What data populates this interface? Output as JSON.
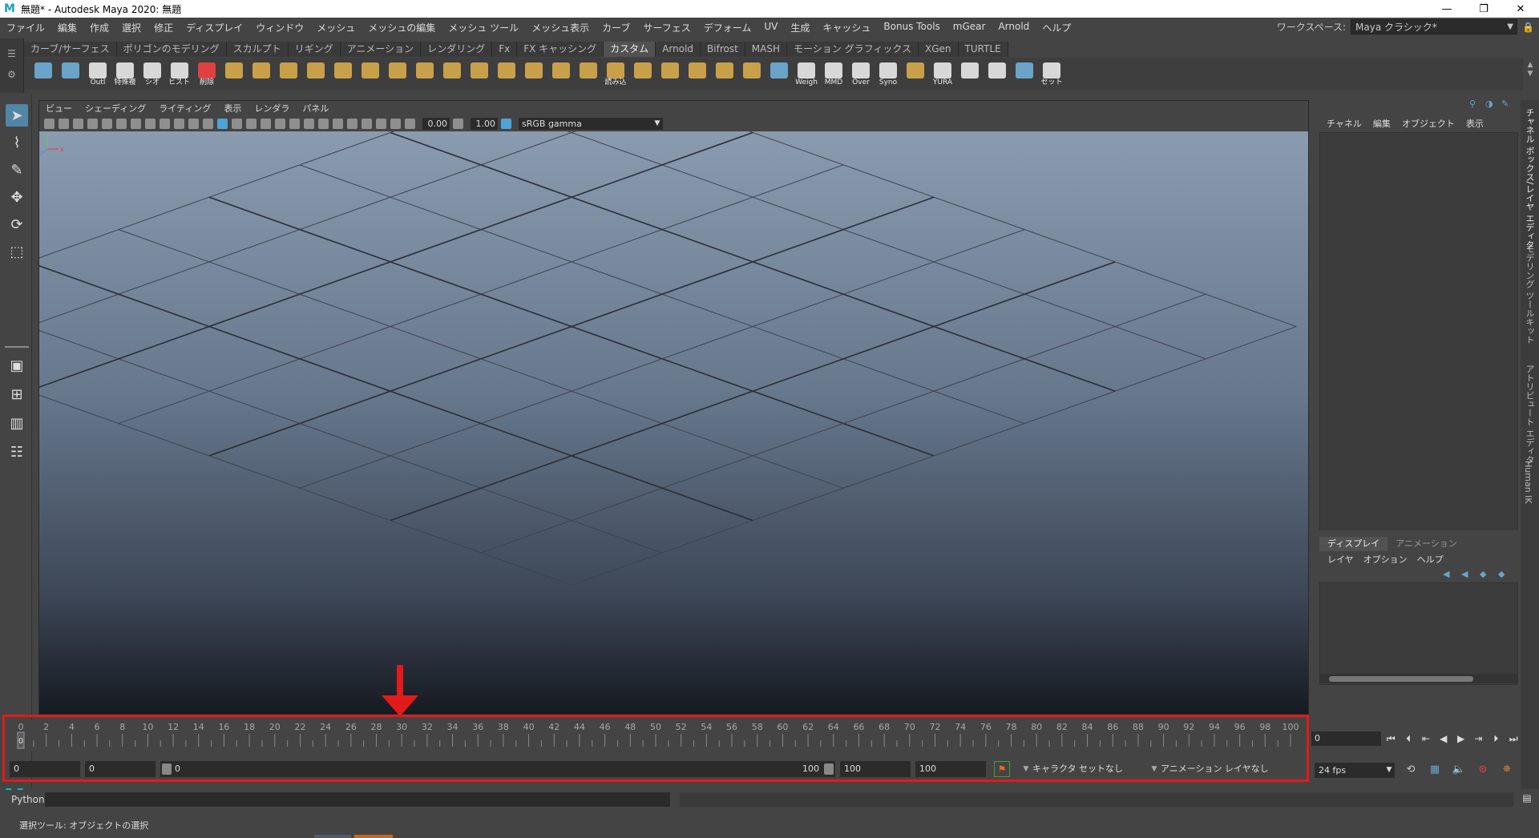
{
  "window": {
    "title": "無題* - Autodesk Maya 2020: 無題",
    "minimize": "—",
    "maximize": "❐",
    "close": "✕"
  },
  "menubar": {
    "items": [
      "ファイル",
      "編集",
      "作成",
      "選択",
      "修正",
      "ディスプレイ",
      "ウィンドウ",
      "メッシュ",
      "メッシュの編集",
      "メッシュ ツール",
      "メッシュ表示",
      "カーブ",
      "サーフェス",
      "デフォーム",
      "UV",
      "生成",
      "キャッシュ",
      "Bonus Tools",
      "mGear",
      "Arnold",
      "ヘルプ"
    ],
    "workspace_label": "ワークスペース:",
    "workspace_value": "Maya クラシック*"
  },
  "shelf_tabs": [
    {
      "label": "カーブ/サーフェス",
      "active": false
    },
    {
      "label": "ポリゴンのモデリング",
      "active": false
    },
    {
      "label": "スカルプト",
      "active": false
    },
    {
      "label": "リギング",
      "active": false
    },
    {
      "label": "アニメーション",
      "active": false
    },
    {
      "label": "レンダリング",
      "active": false
    },
    {
      "label": "Fx",
      "active": false
    },
    {
      "label": "FX キャッシング",
      "active": false
    },
    {
      "label": "カスタム",
      "active": true
    },
    {
      "label": "Arnold",
      "active": false
    },
    {
      "label": "Bifrost",
      "active": false
    },
    {
      "label": "MASH",
      "active": false
    },
    {
      "label": "モーション グラフィックス",
      "active": false
    },
    {
      "label": "XGen",
      "active": false
    },
    {
      "label": "TURTLE",
      "active": false
    }
  ],
  "shelf_icons": [
    {
      "name": "outliner-icon",
      "caption": "",
      "tone": "b"
    },
    {
      "name": "asterisk-icon",
      "caption": "",
      "tone": "b"
    },
    {
      "name": "outl-icon",
      "caption": "Outl",
      "tone": "w"
    },
    {
      "name": "script1-icon",
      "caption": "特殊複",
      "tone": "w"
    },
    {
      "name": "script2-icon",
      "caption": "シオ",
      "tone": "w"
    },
    {
      "name": "script3-icon",
      "caption": "ヒストリ",
      "tone": "w"
    },
    {
      "name": "script4-icon",
      "caption": "削除",
      "tone": "r"
    },
    {
      "name": "tool1-icon",
      "caption": "",
      "tone": ""
    },
    {
      "name": "tool2-icon",
      "caption": "",
      "tone": ""
    },
    {
      "name": "tool3-icon",
      "caption": "",
      "tone": ""
    },
    {
      "name": "tool4-icon",
      "caption": "",
      "tone": ""
    },
    {
      "name": "tool5-icon",
      "caption": "",
      "tone": ""
    },
    {
      "name": "tool6-icon",
      "caption": "",
      "tone": ""
    },
    {
      "name": "tool7-icon",
      "caption": "",
      "tone": ""
    },
    {
      "name": "tool8-icon",
      "caption": "",
      "tone": ""
    },
    {
      "name": "tool9-icon",
      "caption": "",
      "tone": ""
    },
    {
      "name": "tool10-icon",
      "caption": "",
      "tone": ""
    },
    {
      "name": "tool11-icon",
      "caption": "",
      "tone": ""
    },
    {
      "name": "tool12-icon",
      "caption": "",
      "tone": ""
    },
    {
      "name": "tool13-icon",
      "caption": "",
      "tone": ""
    },
    {
      "name": "tool14-icon",
      "caption": "",
      "tone": ""
    },
    {
      "name": "read-icon",
      "caption": "読み込",
      "tone": ""
    },
    {
      "name": "tool15-icon",
      "caption": "",
      "tone": ""
    },
    {
      "name": "tool16-icon",
      "caption": "",
      "tone": ""
    },
    {
      "name": "tool17-icon",
      "caption": "",
      "tone": ""
    },
    {
      "name": "tool18-icon",
      "caption": "",
      "tone": ""
    },
    {
      "name": "tool19-icon",
      "caption": "",
      "tone": ""
    },
    {
      "name": "tool20-icon",
      "caption": "",
      "tone": "b"
    },
    {
      "name": "weigh-icon",
      "caption": "Weigh",
      "tone": "w"
    },
    {
      "name": "mmd-icon",
      "caption": "MMD",
      "tone": "w"
    },
    {
      "name": "over-icon",
      "caption": "Over",
      "tone": "w"
    },
    {
      "name": "syno-icon",
      "caption": "Syno",
      "tone": "w"
    },
    {
      "name": "character-icon",
      "caption": "",
      "tone": ""
    },
    {
      "name": "yura-icon",
      "caption": "YURA",
      "tone": "w"
    },
    {
      "name": "sphere-icon",
      "caption": "",
      "tone": "w"
    },
    {
      "name": "circle-icon",
      "caption": "",
      "tone": "w"
    },
    {
      "name": "tool21-icon",
      "caption": "",
      "tone": "b"
    },
    {
      "name": "set-icon",
      "caption": "セット",
      "tone": "w"
    }
  ],
  "viewport": {
    "menu": [
      "ビュー",
      "シェーディング",
      "ライティング",
      "表示",
      "レンダラ",
      "パネル"
    ],
    "exposure": "0.00",
    "gamma": "1.00",
    "color_space": "sRGB gamma"
  },
  "channel_box": {
    "menu": [
      "チャネル",
      "編集",
      "オブジェクト",
      "表示"
    ],
    "layer_tabs": [
      {
        "label": "ディスプレイ",
        "active": true
      },
      {
        "label": "アニメーション",
        "active": false
      }
    ],
    "layer_menu": [
      "レイヤ",
      "オプション",
      "ヘルプ"
    ]
  },
  "side_tabs": [
    {
      "label": "チャネル ボックス/レイヤ エディタ",
      "active": true
    },
    {
      "label": "モデリング ツールキット",
      "active": false
    },
    {
      "label": "アトリビュート エディタ",
      "active": false
    },
    {
      "label": "Human IK",
      "active": false
    }
  ],
  "timeline": {
    "tick_labels": [
      0,
      2,
      4,
      6,
      8,
      10,
      12,
      14,
      16,
      18,
      20,
      22,
      24,
      26,
      28,
      30,
      32,
      34,
      36,
      38,
      40,
      42,
      44,
      46,
      48,
      50,
      52,
      54,
      56,
      58,
      60,
      62,
      64,
      66,
      68,
      70,
      72,
      74,
      76,
      78,
      80,
      82,
      84,
      86,
      88,
      90,
      92,
      94,
      96,
      98,
      100
    ],
    "current_frame": "0",
    "current_value": 0,
    "marker_color": "#e21a1a"
  },
  "range": {
    "anim_start": "0",
    "play_start": "0",
    "slider_start": "0",
    "slider_end": "100",
    "play_end": "100",
    "anim_end": "100",
    "character_set": "キャラクタ セットなし",
    "anim_layer": "アニメーション レイヤなし",
    "fps": "24 fps"
  },
  "command_line": {
    "language": "Python"
  },
  "help_line": {
    "text": "選択ツール: オブジェクトの選択"
  },
  "highlight_color": "#e21a1a"
}
